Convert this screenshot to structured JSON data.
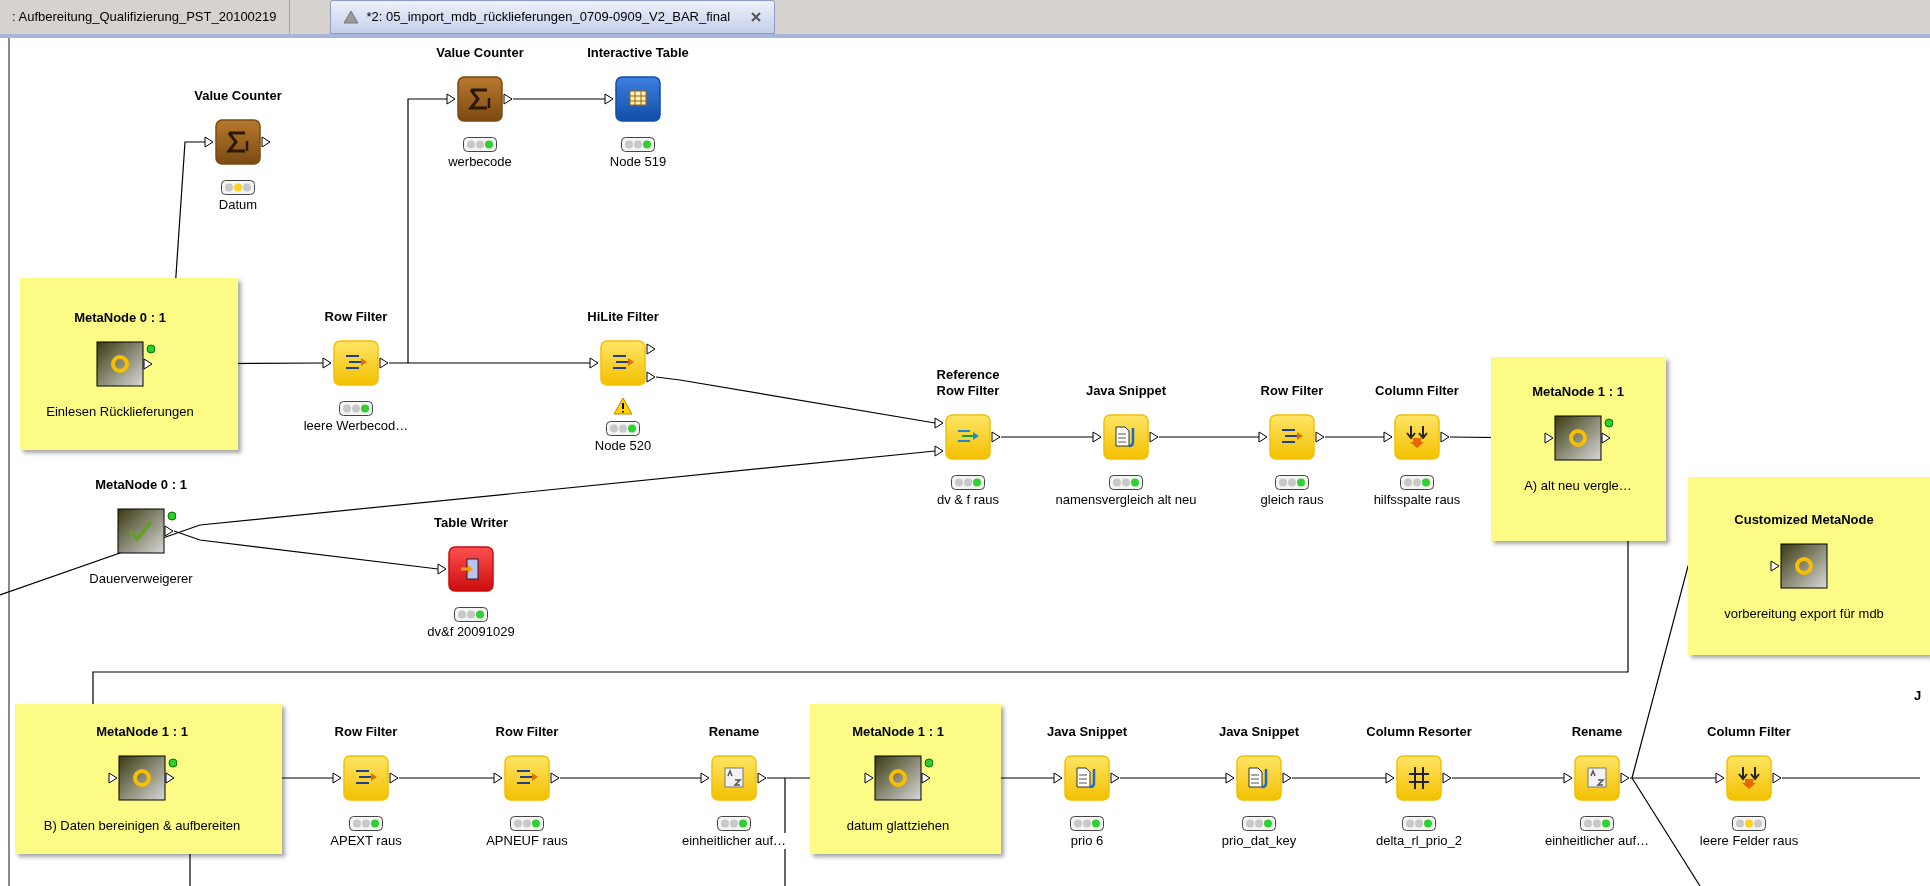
{
  "tabs": [
    {
      "label": ": Aufbereitung_Qualifizierung_PST_20100219",
      "selected": false
    },
    {
      "label": "*2: 05_import_mdb_rücklieferungen_0709-0909_V2_BAR_final",
      "selected": true
    }
  ],
  "nodes": [
    {
      "kind": "value_counter",
      "title": "Value Counter",
      "label": "Datum",
      "executed": false
    },
    {
      "kind": "value_counter",
      "title": "Value Counter",
      "label": "werbecode",
      "executed": true
    },
    {
      "kind": "interactive_table",
      "title": "Interactive Table",
      "label": "Node 519",
      "executed": true
    },
    {
      "kind": "metanode",
      "title": "MetaNode 0 : 1",
      "label": "Einlesen Rücklieferungen",
      "executed": true
    },
    {
      "kind": "row_filter",
      "title": "Row Filter",
      "label": "leere Werbecod…",
      "executed": true
    },
    {
      "kind": "hilite_filter",
      "title": "HiLite Filter",
      "label": "Node 520",
      "executed": true,
      "warning": true
    },
    {
      "kind": "checked_metanode",
      "title": "MetaNode 0 : 1",
      "label": "Dauerverweigerer",
      "executed": true
    },
    {
      "kind": "table_writer",
      "title": "Table Writer",
      "label": "dv&f 20091029",
      "executed": true
    },
    {
      "kind": "reference_row_filter",
      "title": "Reference Row Filter",
      "label": "dv & f raus",
      "executed": true
    },
    {
      "kind": "java_snippet",
      "title": "Java Snippet",
      "label": "namensvergleich alt neu",
      "executed": true
    },
    {
      "kind": "row_filter",
      "title": "Row Filter",
      "label": "gleich raus",
      "executed": true
    },
    {
      "kind": "column_filter",
      "title": "Column Filter",
      "label": "hilfsspalte raus",
      "executed": true
    },
    {
      "kind": "metanode",
      "title": "MetaNode 1 : 1",
      "label": "A) alt neu vergle…",
      "executed": true
    },
    {
      "kind": "metanode",
      "title": "Customized MetaNode",
      "label": "vorbereitung export für mdb",
      "executed": false
    },
    {
      "kind": "metanode",
      "title": "MetaNode 1 : 1",
      "label": "B) Daten bereinigen & aufbereiten",
      "executed": true
    },
    {
      "kind": "row_filter",
      "title": "Row Filter",
      "label": "APEXT raus",
      "executed": true
    },
    {
      "kind": "row_filter",
      "title": "Row Filter",
      "label": "APNEUF raus",
      "executed": true
    },
    {
      "kind": "rename",
      "title": "Rename",
      "label": "einheitlicher auf…",
      "executed": true
    },
    {
      "kind": "metanode",
      "title": "MetaNode 1 : 1",
      "label": "datum glattziehen",
      "executed": true
    },
    {
      "kind": "java_snippet",
      "title": "Java Snippet",
      "label": "prio 6",
      "executed": true
    },
    {
      "kind": "java_snippet",
      "title": "Java Snippet",
      "label": "prio_dat_key",
      "executed": true
    },
    {
      "kind": "column_resorter",
      "title": "Column Resorter",
      "label": "delta_rl_prio_2",
      "executed": true
    },
    {
      "kind": "rename",
      "title": "Rename",
      "label": "einheitlicher auf…",
      "executed": true
    },
    {
      "kind": "column_filter",
      "title": "Column Filter",
      "label": "leere Felder raus",
      "executed": false
    },
    {
      "kind": "partial",
      "title": "J"
    }
  ]
}
